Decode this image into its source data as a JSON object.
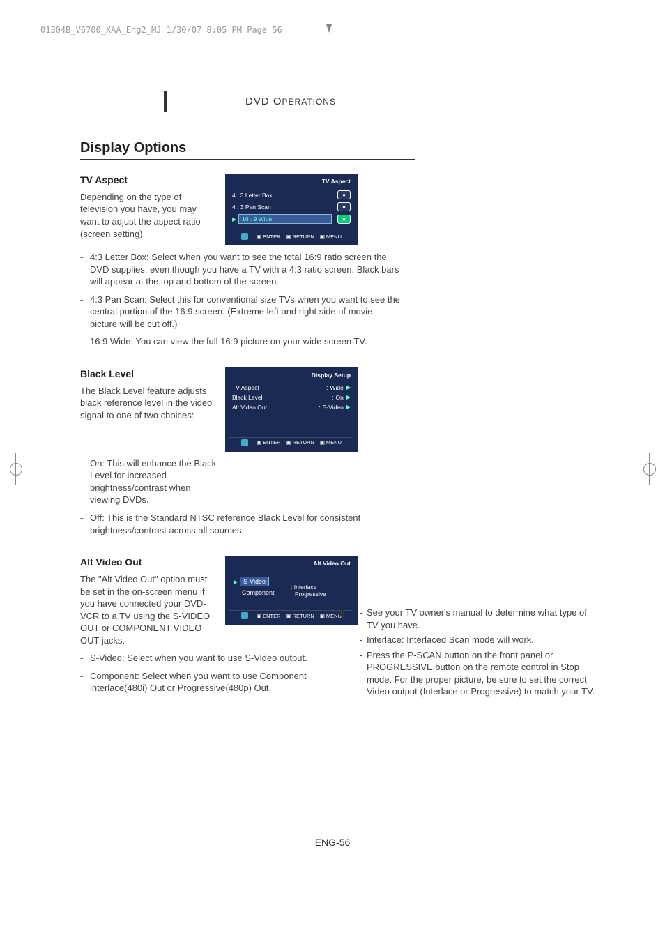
{
  "meta": {
    "header_line": "01304B_V6700_XAA_Eng2_MJ  1/30/07  8:05 PM  Page 56",
    "page_number": "ENG-56"
  },
  "chapter": {
    "title_main": "DVD O",
    "title_smallcaps": "PERATIONS"
  },
  "section": {
    "title": "Display Options"
  },
  "tv_aspect": {
    "title": "TV Aspect",
    "intro": "Depending on the type of television you have, you may want to adjust the aspect ratio (screen setting).",
    "bullets": [
      "4:3 Letter Box: Select when you want to see the total 16:9 ratio screen the DVD supplies, even though you have a TV with a 4:3 ratio screen. Black bars will appear at the top and bottom of the screen.",
      "4:3 Pan Scan: Select this for conventional size TVs when you want to see the central portion of the 16:9 screen. (Extreme left and right side of movie picture will be cut off.)",
      "16:9 Wide: You can view the full 16:9 picture on your wide screen TV."
    ],
    "osd": {
      "title": "TV Aspect",
      "rows": [
        "4 : 3 Letter Box",
        "4 : 3 Pan Scan",
        "16 : 9 Wide"
      ]
    }
  },
  "black_level": {
    "title": "Black Level",
    "intro": "The Black Level feature adjusts black reference level in the video signal to one of two choices:",
    "bullets": [
      "On: This will enhance the Black Level for increased brightness/contrast when viewing DVDs.",
      "Off: This is the Standard NTSC reference Black Level for consistent brightness/contrast across all sources."
    ],
    "osd": {
      "title": "Display Setup",
      "rows": [
        {
          "label": "TV Aspect",
          "value": "Wide"
        },
        {
          "label": "Black Level",
          "value": "On"
        },
        {
          "label": "Alt Video Out",
          "value": "S-Video"
        }
      ]
    }
  },
  "alt_video": {
    "title": "Alt  Video Out",
    "intro": "The \"Alt  Video Out\" option must be set in the on-screen menu if you have connected your DVD-VCR to a TV using the S-VIDEO OUT or COMPONENT VIDEO OUT jacks.",
    "bullets": [
      "S-Video: Select when you want to use S-Video output.",
      "Component: Select when you want to use Component interlace(480i) Out or Progressive(480p) Out."
    ],
    "osd": {
      "title": "Alt Video Out",
      "left": [
        "S-Video",
        "Component"
      ],
      "right": [
        "Interlace",
        "Progressive"
      ]
    }
  },
  "side_notes": {
    "items": [
      "See your TV owner's manual to determine what type of TV you have.",
      "Interlace: Interlaced Scan mode will work.",
      "Press the P-SCAN button on the front panel or PROGRESSIVE button on the remote control in Stop mode. For the proper picture, be sure to set the correct Video output (Interlace or Progressive) to match your TV."
    ]
  },
  "osd_footer": {
    "enter": "ENTER",
    "return": "RETURN",
    "menu": "MENU"
  }
}
